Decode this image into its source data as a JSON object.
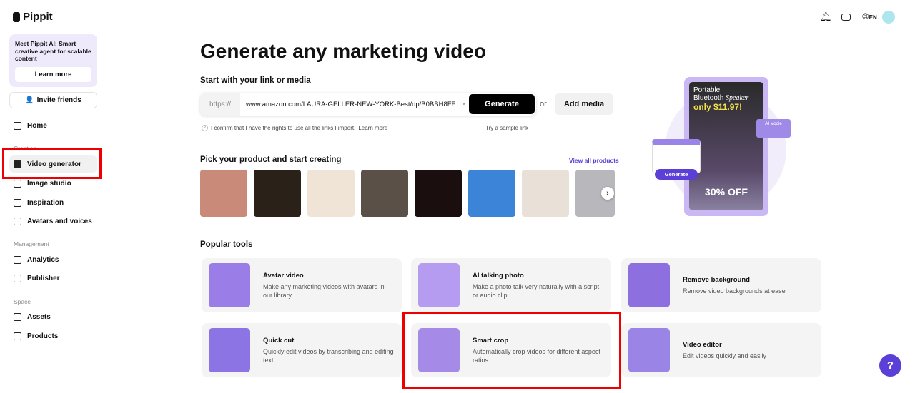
{
  "brand": "Pippit",
  "promo": {
    "text": "Meet Pippit AI: Smart creative agent for scalable content",
    "button": "Learn more"
  },
  "invite": "Invite friends",
  "nav": {
    "home": "Home",
    "creation": "Creation",
    "video_generator": "Video generator",
    "image_studio": "Image studio",
    "inspiration": "Inspiration",
    "avatars": "Avatars and voices",
    "management": "Management",
    "analytics": "Analytics",
    "publisher": "Publisher",
    "space": "Space",
    "assets": "Assets",
    "products": "Products"
  },
  "header": {
    "lang": "EN"
  },
  "main": {
    "title": "Generate any marketing video",
    "link_heading": "Start with your link or media",
    "url_prefix": "https://",
    "url_value": "www.amazon.com/LAURA-GELLER-NEW-YORK-Best/dp/B0BBH8FF",
    "generate": "Generate",
    "or": "or",
    "add_media": "Add media",
    "confirm": "I confirm that I have the rights to use all the links I import.",
    "confirm_link": "Learn more",
    "sample": "Try a sample link",
    "products_heading": "Pick your product and start creating",
    "view_all": "View all products",
    "product_colors": [
      "#c98a7a",
      "#2a2118",
      "#efe4d6",
      "#5a5048",
      "#1a0e0e",
      "#3c84d8",
      "#e9e1d8",
      "#b8b8bc"
    ],
    "hero": {
      "line1": "Portable",
      "line2": "Bluetooth",
      "line2b": "Speaker",
      "price": "only $11.97!",
      "ai_voice": "AI Vocie",
      "generate": "Generate",
      "discount": "30% OFF"
    },
    "popular_heading": "Popular tools",
    "tools": [
      {
        "title": "Avatar video",
        "desc": "Make any marketing videos with avatars in our library"
      },
      {
        "title": "AI talking photo",
        "desc": "Make a photo talk very naturally with a script or audio clip"
      },
      {
        "title": "Remove background",
        "desc": "Remove video backgrounds at ease"
      },
      {
        "title": "Quick cut",
        "desc": "Quickly edit videos by transcribing and editing text"
      },
      {
        "title": "Smart crop",
        "desc": "Automatically crop videos for different aspect ratios"
      },
      {
        "title": "Video editor",
        "desc": "Edit videos quickly and easily"
      }
    ]
  },
  "help": "?",
  "colors": {
    "accent": "#5b3fd6",
    "highlight": "#e00000"
  }
}
